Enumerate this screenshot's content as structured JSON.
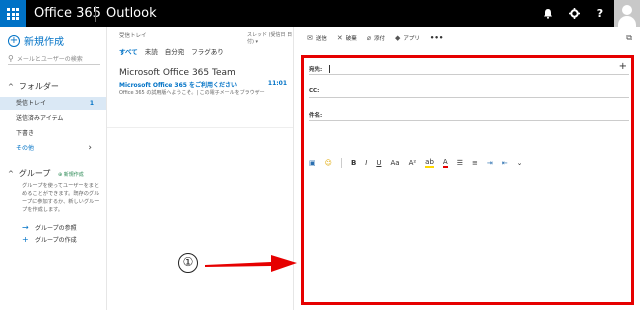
{
  "topbar": {
    "brand": "Office 365",
    "app": "Outlook",
    "bell_icon": "bell-icon",
    "settings_icon": "gear-icon",
    "help_label": "?"
  },
  "leftnav": {
    "new_mail": "新規作成",
    "search_placeholder": "メールとユーザーの検索",
    "folders_heading": "フォルダー",
    "folders": [
      {
        "label": "受信トレイ",
        "count": "1"
      },
      {
        "label": "送信済みアイテム",
        "count": ""
      },
      {
        "label": "下書き",
        "count": ""
      },
      {
        "label": "その他",
        "count": ""
      }
    ],
    "groups_heading": "グループ",
    "groups_new": "新規作成",
    "groups_desc": "グループを使ってユーザーをまとめることができます。既存のグループに参加するか、新しいグループを作成します。",
    "group_actions": [
      {
        "icon": "arrow-right-icon",
        "label": "グループの参照"
      },
      {
        "icon": "plus-icon",
        "label": "グループの作成"
      }
    ]
  },
  "msglist": {
    "inbox_label": "受信トレイ",
    "sort_label": "スレッド (受信日 日付) ▾",
    "tabs": [
      "すべて",
      "未読",
      "自分宛",
      "フラグあり"
    ],
    "message": {
      "from": "Microsoft Office 365 Team",
      "subject": "Microsoft Office 365 をご利用ください",
      "time": "11:01",
      "preview": "Office 365 の試用版へようこそ。| この電子メールをブラウザー"
    }
  },
  "reading": {
    "toolbar": [
      {
        "icon": "send-icon",
        "label": "送信"
      },
      {
        "icon": "discard-icon",
        "label": "破棄"
      },
      {
        "icon": "paperclip-icon",
        "label": "添付"
      },
      {
        "icon": "apps-icon",
        "label": "アプリ"
      }
    ],
    "more_label": "•••",
    "to_label": "宛先:",
    "cc_label": "CC:",
    "subject_label": "件名:",
    "format_icons": [
      "image-icon",
      "emoji-icon",
      "bold-icon",
      "italic-icon",
      "underline-icon",
      "font-size-icon",
      "superscript-icon",
      "highlight-icon",
      "font-color-icon",
      "bullets-icon",
      "numbering-icon",
      "indent-icon",
      "outdent-icon",
      "more-chevron-icon"
    ]
  },
  "annotation": {
    "callout_number": "①",
    "highlight_color": "#e60000"
  }
}
